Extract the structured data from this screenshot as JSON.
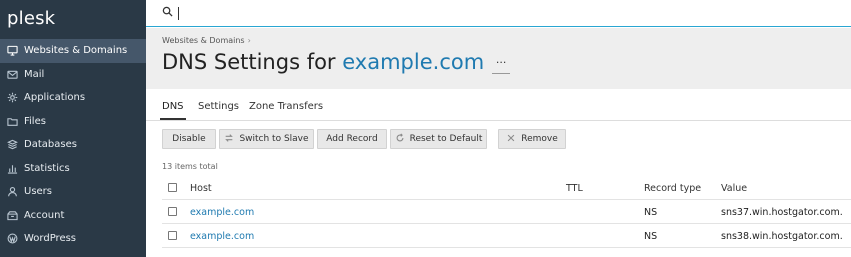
{
  "app": {
    "logo": "plesk"
  },
  "sidebar": {
    "items": [
      {
        "label": "Websites & Domains",
        "icon": "monitor-icon",
        "active": true
      },
      {
        "label": "Mail",
        "icon": "envelope-icon"
      },
      {
        "label": "Applications",
        "icon": "gear-icon"
      },
      {
        "label": "Files",
        "icon": "folder-icon"
      },
      {
        "label": "Databases",
        "icon": "database-icon"
      },
      {
        "label": "Statistics",
        "icon": "bar-chart-icon"
      },
      {
        "label": "Users",
        "icon": "user-icon"
      },
      {
        "label": "Account",
        "icon": "briefcase-icon"
      },
      {
        "label": "WordPress",
        "icon": "wordpress-icon"
      }
    ]
  },
  "search": {
    "value": "",
    "placeholder": ""
  },
  "header": {
    "breadcrumb": "Websites & Domains",
    "title_prefix": "DNS Settings for ",
    "title_domain": "example.com",
    "more": "···"
  },
  "tabs": [
    {
      "label": "DNS",
      "active": true
    },
    {
      "label": "Settings"
    },
    {
      "label": "Zone Transfers"
    }
  ],
  "toolbar": {
    "disable": "Disable",
    "switch_to_slave": "Switch to Slave",
    "add_record": "Add Record",
    "reset_to_default": "Reset to Default",
    "remove": "Remove"
  },
  "list": {
    "items_total": "13 items total",
    "columns": {
      "host": "Host",
      "ttl": "TTL",
      "record_type": "Record type",
      "value": "Value"
    },
    "rows": [
      {
        "host": "example.com",
        "ttl": "",
        "record_type": "NS",
        "value": "sns37.win.hostgator.com."
      },
      {
        "host": "example.com",
        "ttl": "",
        "record_type": "NS",
        "value": "sns38.win.hostgator.com."
      }
    ]
  },
  "colors": {
    "sidebar_bg": "#2a3946",
    "sidebar_active": "#45576a",
    "accent": "#1f7ab0",
    "search_border": "#2aa6d2"
  }
}
